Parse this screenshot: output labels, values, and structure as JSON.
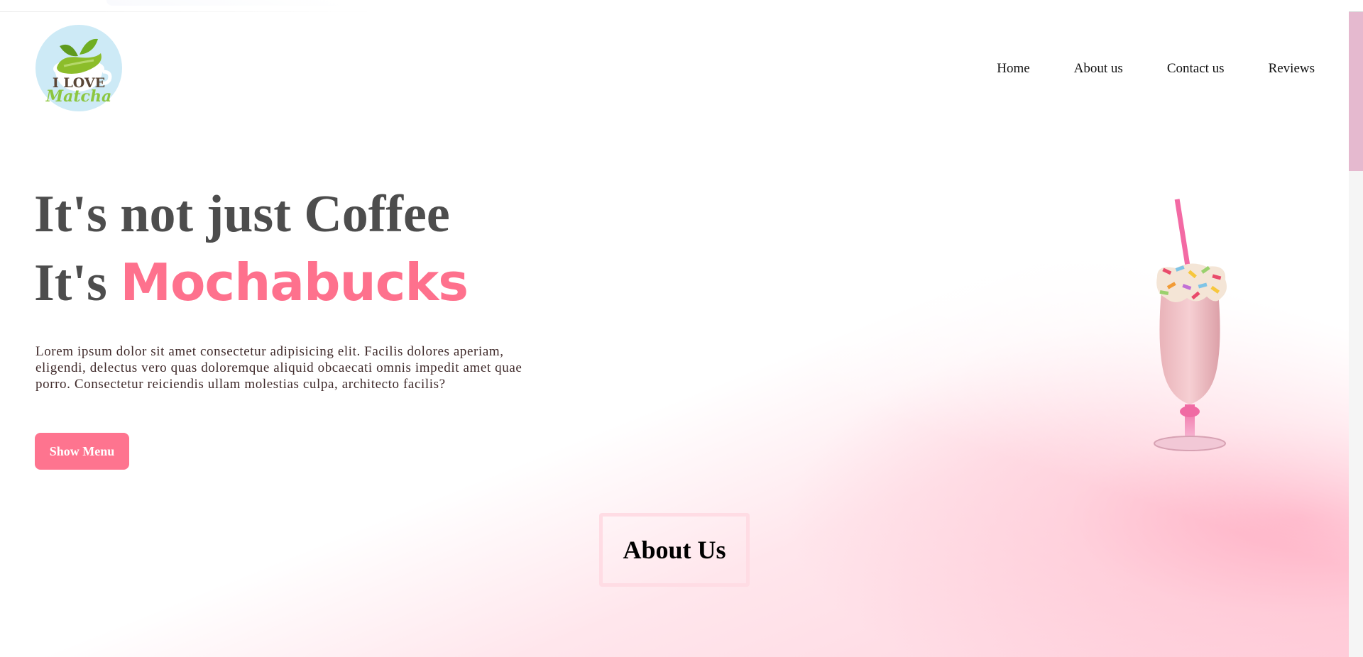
{
  "header": {
    "logo": {
      "line1": "I LOVE",
      "line2": "Matcha",
      "colors": {
        "circle": "#cdeaf6",
        "leaf": "#8cbd2a",
        "text_dark": "#5a4636",
        "text_green": "#8cc63f"
      }
    },
    "nav": [
      {
        "label": "Home"
      },
      {
        "label": "About us"
      },
      {
        "label": "Contact us"
      },
      {
        "label": "Reviews"
      }
    ]
  },
  "hero": {
    "line1": "It's not just Coffee",
    "line2_prefix": "It's ",
    "brand": "Mochabucks",
    "description": "Lorem ipsum dolor sit amet consectetur adipisicing elit. Facilis dolores aperiam, eligendi, delectus vero quas doloremque aliquid obcaecati omnis impedit amet quae porro. Consectetur reiciendis ullam molestias culpa, architecto facilis?",
    "button_label": "Show Menu"
  },
  "about": {
    "title": "About Us"
  },
  "colors": {
    "accent": "#fe718d",
    "heading": "#4d4d4d",
    "about_border": "#ffdce4",
    "scroll_thumb": "#e5b9cf"
  }
}
